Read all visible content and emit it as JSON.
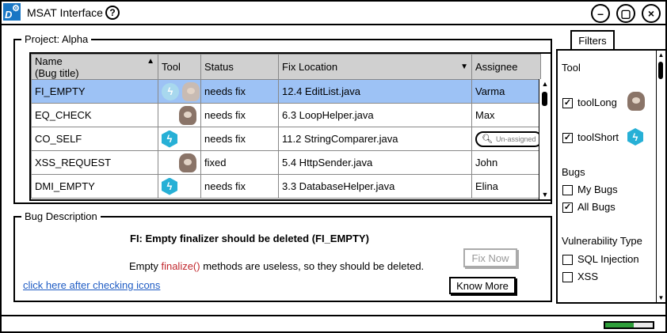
{
  "window": {
    "title": "MSAT Interface",
    "logo_text": "D"
  },
  "project": {
    "legend": "Project: Alpha",
    "columns": {
      "name": "Name",
      "name_sub": "(Bug title)",
      "tool": "Tool",
      "status": "Status",
      "fix_location": "Fix Location",
      "assignee": "Assignee"
    },
    "rows": [
      {
        "name": "FI_EMPTY",
        "tools": [
          "bolt-faded",
          "sloth-faded"
        ],
        "status": "needs fix",
        "location": "12.4 EditList.java",
        "assignee": "Varma",
        "selected": true
      },
      {
        "name": "EQ_CHECK",
        "tools": [
          "sloth"
        ],
        "status": "needs fix",
        "location": "6.3 LoopHelper.java",
        "assignee": "Max",
        "selected": false
      },
      {
        "name": "CO_SELF",
        "tools": [
          "bolt"
        ],
        "status": "needs fix",
        "location": "11.2 StringComparer.java",
        "assignee": "",
        "selected": false
      },
      {
        "name": "XSS_REQUEST",
        "tools": [
          "sloth"
        ],
        "status": "fixed",
        "location": "5.4 HttpSender.java",
        "assignee": "John",
        "selected": false
      },
      {
        "name": "DMI_EMPTY",
        "tools": [
          "bolt"
        ],
        "status": "needs fix",
        "location": "3.3 DatabaseHelper.java",
        "assignee": "Elina",
        "selected": false
      }
    ],
    "unassigned_placeholder": "Un-assigned"
  },
  "bug_description": {
    "legend": "Bug Description",
    "title": "FI: Empty finalizer should be deleted (FI_EMPTY)",
    "text_before": "Empty ",
    "text_code": "finalize()",
    "text_after": " methods are useless, so they should be deleted.",
    "link": "click here after checking icons",
    "fix_now": "Fix Now",
    "know_more": "Know More"
  },
  "filters": {
    "tab": "Filters",
    "tool_heading": "Tool",
    "tool_long": "toolLong",
    "tool_short": "toolShort",
    "bugs_heading": "Bugs",
    "my_bugs": "My Bugs",
    "all_bugs": "All Bugs",
    "vuln_heading": "Vulnerability Type",
    "sql_injection": "SQL Injection",
    "xss": "XSS"
  },
  "status": {
    "progress": 0.6
  },
  "colors": {
    "selection": "#9dc2f5",
    "accent": "#27b0d6",
    "link": "#1f5cc4",
    "code": "#c1272d",
    "progress": "#2e9e3a"
  }
}
